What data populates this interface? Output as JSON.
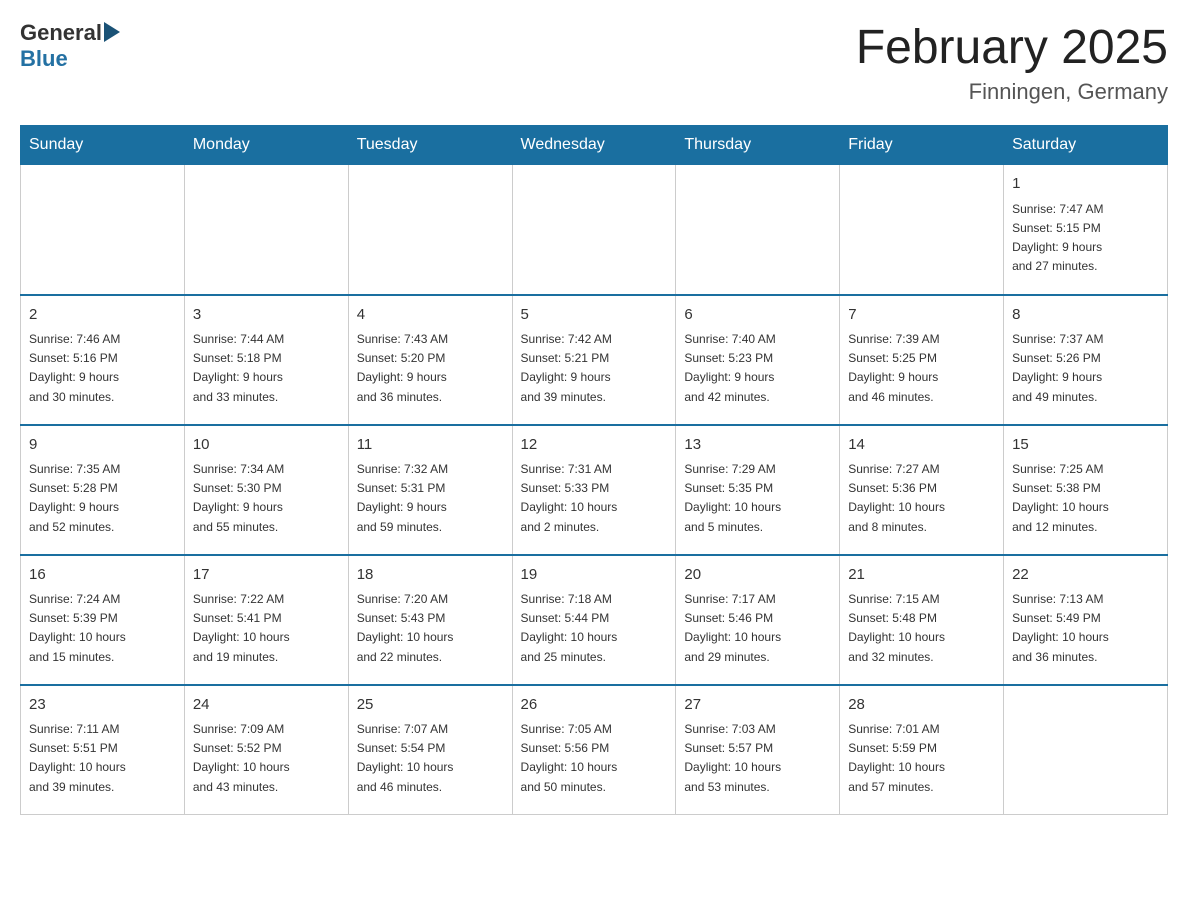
{
  "header": {
    "logo_text": "General",
    "logo_blue": "Blue",
    "month": "February 2025",
    "location": "Finningen, Germany"
  },
  "weekdays": [
    "Sunday",
    "Monday",
    "Tuesday",
    "Wednesday",
    "Thursday",
    "Friday",
    "Saturday"
  ],
  "weeks": [
    [
      {
        "day": "",
        "info": ""
      },
      {
        "day": "",
        "info": ""
      },
      {
        "day": "",
        "info": ""
      },
      {
        "day": "",
        "info": ""
      },
      {
        "day": "",
        "info": ""
      },
      {
        "day": "",
        "info": ""
      },
      {
        "day": "1",
        "info": "Sunrise: 7:47 AM\nSunset: 5:15 PM\nDaylight: 9 hours\nand 27 minutes."
      }
    ],
    [
      {
        "day": "2",
        "info": "Sunrise: 7:46 AM\nSunset: 5:16 PM\nDaylight: 9 hours\nand 30 minutes."
      },
      {
        "day": "3",
        "info": "Sunrise: 7:44 AM\nSunset: 5:18 PM\nDaylight: 9 hours\nand 33 minutes."
      },
      {
        "day": "4",
        "info": "Sunrise: 7:43 AM\nSunset: 5:20 PM\nDaylight: 9 hours\nand 36 minutes."
      },
      {
        "day": "5",
        "info": "Sunrise: 7:42 AM\nSunset: 5:21 PM\nDaylight: 9 hours\nand 39 minutes."
      },
      {
        "day": "6",
        "info": "Sunrise: 7:40 AM\nSunset: 5:23 PM\nDaylight: 9 hours\nand 42 minutes."
      },
      {
        "day": "7",
        "info": "Sunrise: 7:39 AM\nSunset: 5:25 PM\nDaylight: 9 hours\nand 46 minutes."
      },
      {
        "day": "8",
        "info": "Sunrise: 7:37 AM\nSunset: 5:26 PM\nDaylight: 9 hours\nand 49 minutes."
      }
    ],
    [
      {
        "day": "9",
        "info": "Sunrise: 7:35 AM\nSunset: 5:28 PM\nDaylight: 9 hours\nand 52 minutes."
      },
      {
        "day": "10",
        "info": "Sunrise: 7:34 AM\nSunset: 5:30 PM\nDaylight: 9 hours\nand 55 minutes."
      },
      {
        "day": "11",
        "info": "Sunrise: 7:32 AM\nSunset: 5:31 PM\nDaylight: 9 hours\nand 59 minutes."
      },
      {
        "day": "12",
        "info": "Sunrise: 7:31 AM\nSunset: 5:33 PM\nDaylight: 10 hours\nand 2 minutes."
      },
      {
        "day": "13",
        "info": "Sunrise: 7:29 AM\nSunset: 5:35 PM\nDaylight: 10 hours\nand 5 minutes."
      },
      {
        "day": "14",
        "info": "Sunrise: 7:27 AM\nSunset: 5:36 PM\nDaylight: 10 hours\nand 8 minutes."
      },
      {
        "day": "15",
        "info": "Sunrise: 7:25 AM\nSunset: 5:38 PM\nDaylight: 10 hours\nand 12 minutes."
      }
    ],
    [
      {
        "day": "16",
        "info": "Sunrise: 7:24 AM\nSunset: 5:39 PM\nDaylight: 10 hours\nand 15 minutes."
      },
      {
        "day": "17",
        "info": "Sunrise: 7:22 AM\nSunset: 5:41 PM\nDaylight: 10 hours\nand 19 minutes."
      },
      {
        "day": "18",
        "info": "Sunrise: 7:20 AM\nSunset: 5:43 PM\nDaylight: 10 hours\nand 22 minutes."
      },
      {
        "day": "19",
        "info": "Sunrise: 7:18 AM\nSunset: 5:44 PM\nDaylight: 10 hours\nand 25 minutes."
      },
      {
        "day": "20",
        "info": "Sunrise: 7:17 AM\nSunset: 5:46 PM\nDaylight: 10 hours\nand 29 minutes."
      },
      {
        "day": "21",
        "info": "Sunrise: 7:15 AM\nSunset: 5:48 PM\nDaylight: 10 hours\nand 32 minutes."
      },
      {
        "day": "22",
        "info": "Sunrise: 7:13 AM\nSunset: 5:49 PM\nDaylight: 10 hours\nand 36 minutes."
      }
    ],
    [
      {
        "day": "23",
        "info": "Sunrise: 7:11 AM\nSunset: 5:51 PM\nDaylight: 10 hours\nand 39 minutes."
      },
      {
        "day": "24",
        "info": "Sunrise: 7:09 AM\nSunset: 5:52 PM\nDaylight: 10 hours\nand 43 minutes."
      },
      {
        "day": "25",
        "info": "Sunrise: 7:07 AM\nSunset: 5:54 PM\nDaylight: 10 hours\nand 46 minutes."
      },
      {
        "day": "26",
        "info": "Sunrise: 7:05 AM\nSunset: 5:56 PM\nDaylight: 10 hours\nand 50 minutes."
      },
      {
        "day": "27",
        "info": "Sunrise: 7:03 AM\nSunset: 5:57 PM\nDaylight: 10 hours\nand 53 minutes."
      },
      {
        "day": "28",
        "info": "Sunrise: 7:01 AM\nSunset: 5:59 PM\nDaylight: 10 hours\nand 57 minutes."
      },
      {
        "day": "",
        "info": ""
      }
    ]
  ]
}
